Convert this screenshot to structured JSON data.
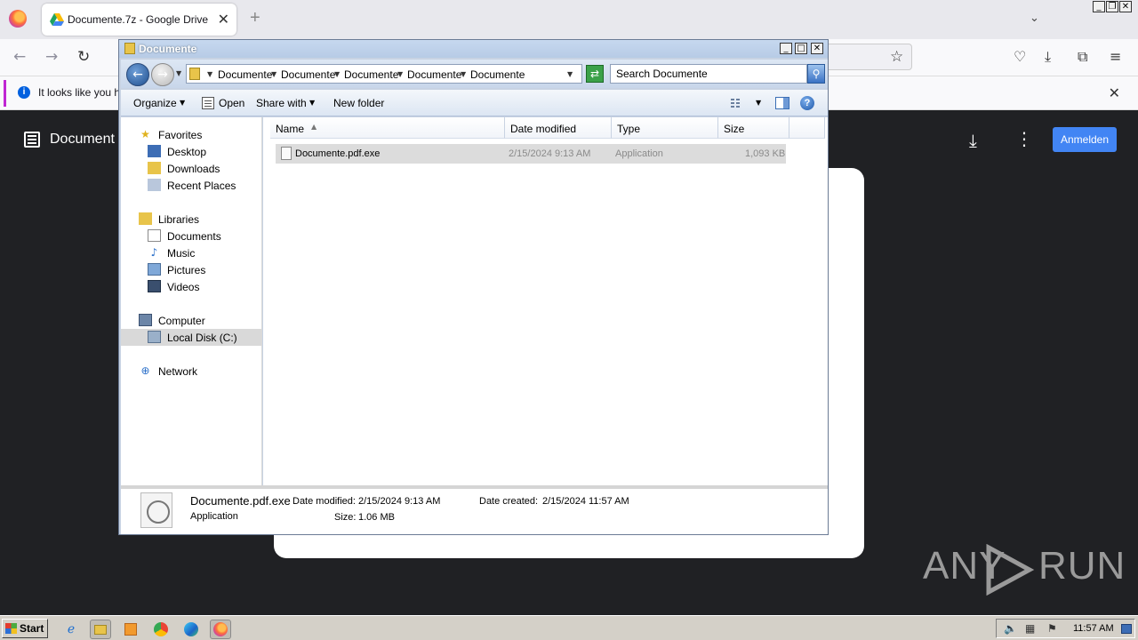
{
  "browser": {
    "tab_title": "Documente.7z - Google Drive",
    "infobar_text": "It looks like you ha"
  },
  "drive": {
    "title": "Document",
    "signin_label": "Anmelden"
  },
  "watermark": {
    "text_left": "ANY",
    "text_right": "RUN"
  },
  "explorer": {
    "title": "Documente",
    "breadcrumbs": [
      "Documente",
      "Documente",
      "Documente",
      "Documente",
      "Documente"
    ],
    "search_placeholder": "Search Documente",
    "commands": {
      "organize": "Organize",
      "open": "Open",
      "share_with": "Share with",
      "new_folder": "New folder"
    },
    "nav": {
      "favorites": "Favorites",
      "desktop": "Desktop",
      "downloads": "Downloads",
      "recent_places": "Recent Places",
      "libraries": "Libraries",
      "documents": "Documents",
      "music": "Music",
      "pictures": "Pictures",
      "videos": "Videos",
      "computer": "Computer",
      "local_disk": "Local Disk (C:)",
      "network": "Network"
    },
    "columns": {
      "name": "Name",
      "date_modified": "Date modified",
      "type": "Type",
      "size": "Size"
    },
    "files": [
      {
        "name": "Documente.pdf.exe",
        "date_modified": "2/15/2024 9:13 AM",
        "type": "Application",
        "size": "1,093 KB"
      }
    ],
    "details": {
      "name": "Documente.pdf.exe",
      "type": "Application",
      "date_modified_label": "Date modified:",
      "date_modified": "2/15/2024 9:13 AM",
      "date_created_label": "Date created:",
      "date_created": "2/15/2024 11:57 AM",
      "size_label": "Size:",
      "size": "1.06 MB"
    }
  },
  "taskbar": {
    "start_label": "Start",
    "clock": "11:57 AM"
  }
}
